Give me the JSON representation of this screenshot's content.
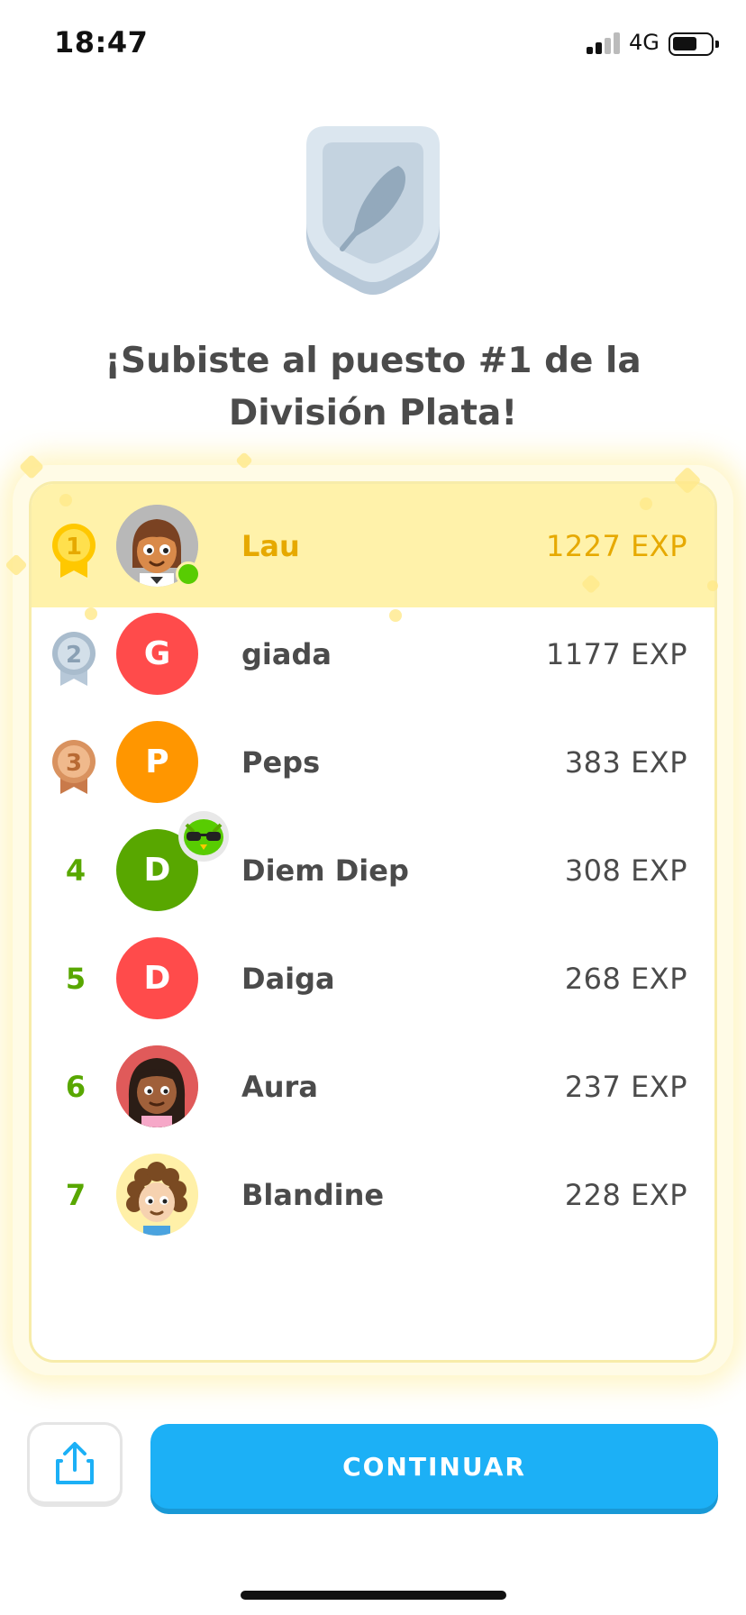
{
  "status_bar": {
    "time": "18:47",
    "network": "4G"
  },
  "headline": {
    "line1": "¡Subiste al puesto #1 de la",
    "line2": "División Plata!"
  },
  "leaderboard": [
    {
      "rank": "1",
      "name": "Lau",
      "xp": "1227 EXP",
      "avatar": "girl-avatar",
      "medal": "gold"
    },
    {
      "rank": "2",
      "name": "giada",
      "xp": "1177 EXP",
      "initial": "G",
      "color": "#ff4b4b",
      "medal": "silver"
    },
    {
      "rank": "3",
      "name": "Peps",
      "xp": "383 EXP",
      "initial": "P",
      "color": "#ff9600",
      "medal": "bronze"
    },
    {
      "rank": "4",
      "name": "Diem Diep",
      "xp": "308 EXP",
      "initial": "D",
      "color": "#58a700"
    },
    {
      "rank": "5",
      "name": "Daiga",
      "xp": "268 EXP",
      "initial": "D",
      "color": "#ff4b4b"
    },
    {
      "rank": "6",
      "name": "Aura",
      "xp": "237 EXP",
      "avatar": "woman-avatar"
    },
    {
      "rank": "7",
      "name": "Blandine",
      "xp": "228 EXP",
      "avatar": "curly-girl-avatar"
    }
  ],
  "buttons": {
    "continue_label": "CONTINUAR",
    "share_icon": "share-icon"
  },
  "colors": {
    "accent": "#1cb0f6",
    "gold": "#e6a900",
    "rank_green": "#58a700"
  }
}
